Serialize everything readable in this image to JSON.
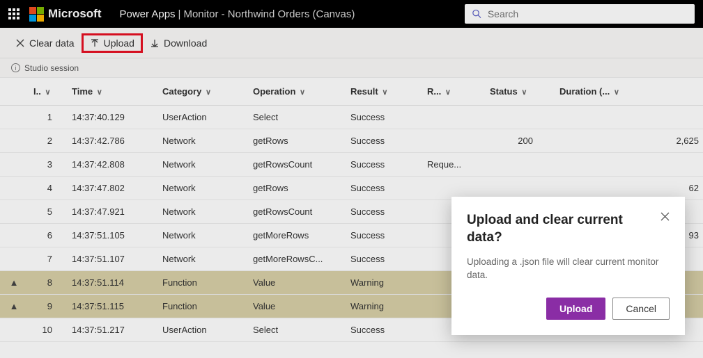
{
  "header": {
    "brand": "Microsoft",
    "app": "Power Apps",
    "divider": " | ",
    "context": "Monitor - Northwind Orders (Canvas)"
  },
  "search": {
    "placeholder": "Search"
  },
  "toolbar": {
    "clear": "Clear data",
    "upload": "Upload",
    "download": "Download"
  },
  "session": {
    "label": "Studio session"
  },
  "columns": {
    "id": "I..",
    "time": "Time",
    "category": "Category",
    "operation": "Operation",
    "result": "Result",
    "r": "R...",
    "status": "Status",
    "duration": "Duration (..."
  },
  "rows": [
    {
      "icon": "",
      "id": "1",
      "time": "14:37:40.129",
      "category": "UserAction",
      "operation": "Select",
      "result": "Success",
      "r": "",
      "status": "",
      "duration": "",
      "warn": false
    },
    {
      "icon": "",
      "id": "2",
      "time": "14:37:42.786",
      "category": "Network",
      "operation": "getRows",
      "result": "Success",
      "r": "",
      "status": "200",
      "duration": "2,625",
      "warn": false
    },
    {
      "icon": "",
      "id": "3",
      "time": "14:37:42.808",
      "category": "Network",
      "operation": "getRowsCount",
      "result": "Success",
      "r": "Reque...",
      "status": "",
      "duration": "",
      "warn": false
    },
    {
      "icon": "",
      "id": "4",
      "time": "14:37:47.802",
      "category": "Network",
      "operation": "getRows",
      "result": "Success",
      "r": "",
      "status": "",
      "duration": "62",
      "warn": false
    },
    {
      "icon": "",
      "id": "5",
      "time": "14:37:47.921",
      "category": "Network",
      "operation": "getRowsCount",
      "result": "Success",
      "r": "",
      "status": "",
      "duration": "",
      "warn": false
    },
    {
      "icon": "",
      "id": "6",
      "time": "14:37:51.105",
      "category": "Network",
      "operation": "getMoreRows",
      "result": "Success",
      "r": "",
      "status": "",
      "duration": "93",
      "warn": false
    },
    {
      "icon": "",
      "id": "7",
      "time": "14:37:51.107",
      "category": "Network",
      "operation": "getMoreRowsC...",
      "result": "Success",
      "r": "",
      "status": "",
      "duration": "",
      "warn": false
    },
    {
      "icon": "▲",
      "id": "8",
      "time": "14:37:51.114",
      "category": "Function",
      "operation": "Value",
      "result": "Warning",
      "r": "",
      "status": "",
      "duration": "",
      "warn": true
    },
    {
      "icon": "▲",
      "id": "9",
      "time": "14:37:51.115",
      "category": "Function",
      "operation": "Value",
      "result": "Warning",
      "r": "",
      "status": "",
      "duration": "",
      "warn": true
    },
    {
      "icon": "",
      "id": "10",
      "time": "14:37:51.217",
      "category": "UserAction",
      "operation": "Select",
      "result": "Success",
      "r": "",
      "status": "",
      "duration": "",
      "warn": false
    }
  ],
  "dialog": {
    "title": "Upload and clear current data?",
    "body": "Uploading a .json file will clear current monitor data.",
    "primary": "Upload",
    "secondary": "Cancel"
  }
}
